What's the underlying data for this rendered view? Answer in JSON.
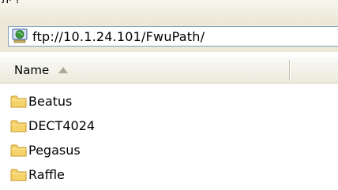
{
  "menu_fragment": "ית ?",
  "address": {
    "value": "ftp://10.1.24.101/FwuPath/",
    "icon": "ftp-globe-icon"
  },
  "columns": [
    {
      "label": "Name",
      "sort": "ascending"
    }
  ],
  "items": [
    {
      "name": "Beatus",
      "icon": "folder-icon"
    },
    {
      "name": "DECT4024",
      "icon": "folder-icon"
    },
    {
      "name": "Pegasus",
      "icon": "folder-icon"
    },
    {
      "name": "Raffle",
      "icon": "folder-icon"
    }
  ],
  "colors": {
    "folder": "#f5d26a",
    "folder_edge": "#c79a28",
    "toolbar": "#ece9d8",
    "address_border": "#7f9db9"
  }
}
